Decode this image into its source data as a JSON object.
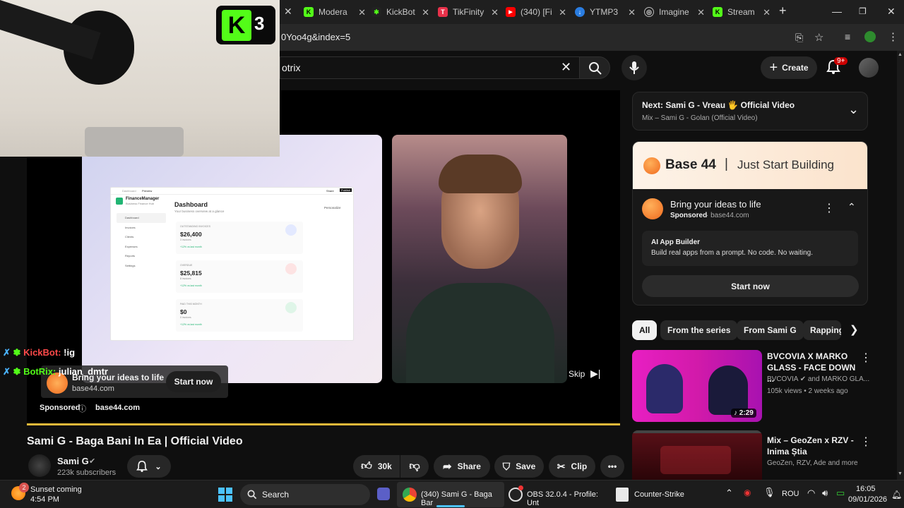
{
  "browser": {
    "tabs": [
      {
        "label": "Modera",
        "color": "#53fc18",
        "glyph": "K"
      },
      {
        "label": "KickBot",
        "color": "#1a1a1a",
        "glyph": "✱"
      },
      {
        "label": "TikFinity",
        "color": "#e8314a",
        "glyph": "T"
      },
      {
        "label": "(340) [Fi",
        "color": "#ff0000",
        "glyph": "▶"
      },
      {
        "label": "YTMP3",
        "color": "#2a7de1",
        "glyph": "↓"
      },
      {
        "label": "Imagine",
        "color": "#3a3a3a",
        "glyph": "◎"
      },
      {
        "label": "Stream",
        "color": "#53fc18",
        "glyph": "K"
      }
    ],
    "url": "0Yoo4g&index=5"
  },
  "header": {
    "search_query": "otrix",
    "create_label": "Create",
    "notif_badge": "9+"
  },
  "overlay": {
    "kick_number": "3",
    "chat": [
      {
        "user": "KickBot:",
        "msg": "!ig",
        "color": "#ff4a4a"
      },
      {
        "user": "BotRix:",
        "msg": "julian_dmtr",
        "color": "#53fc18"
      }
    ]
  },
  "ad": {
    "dashboard": {
      "app_name": "FinanceManager",
      "app_sub": "Business Finance Hub",
      "title": "Dashboard",
      "subtitle": "Your business overview at a glance",
      "personalize": "Personalize",
      "topbar": [
        "Dashboard",
        "Preview"
      ],
      "share": "Share",
      "publish": "Publish",
      "nav": [
        "Dashboard",
        "Invoices",
        "Clients",
        "Expenses",
        "Reports",
        "Settings"
      ],
      "cards": [
        {
          "label": "OUTSTANDING INVOICES",
          "value": "$26,400",
          "sub": "3 invoices",
          "trend": "+12% vs last month"
        },
        {
          "label": "OVERDUE",
          "value": "$25,815",
          "sub": "8 invoices",
          "trend": "+12% vs last month"
        },
        {
          "label": "PAID THIS MONTH",
          "value": "$0",
          "sub": "0 invoices",
          "trend": "+12% vs last month"
        }
      ]
    },
    "title": "Bring your ideas to life",
    "domain": "base44.com",
    "cta": "Start now",
    "sponsored": "Sponsored",
    "skip": "Skip"
  },
  "video": {
    "title": "Sami G - Baga Bani In Ea | Official Video",
    "channel": "Sami G",
    "subscribers": "223k subscribers",
    "likes": "30k",
    "share": "Share",
    "save": "Save",
    "clip": "Clip"
  },
  "sidebar": {
    "next_label": "Next: Sami G - Vreau 🖐 Official Video",
    "next_sub": "Mix – Sami G - Golan (Official Video)",
    "ad_brand": "Base 44",
    "ad_tagline": "Just Start Building",
    "ad_title": "Bring your ideas to life",
    "ad_sponsored": "Sponsored",
    "ad_domain": "base44.com",
    "ad_card_title": "AI App Builder",
    "ad_card_desc": "Build real apps from a prompt. No code. No waiting.",
    "ad_cta": "Start now",
    "chips": [
      "All",
      "From the series",
      "From Sami G",
      "Rapping"
    ],
    "videos": [
      {
        "title": "BVCOVIA X MARKO GLASS - FACE DOWN ...",
        "channel": "BVCOVIA",
        "channel_extra": "and MARKO GLA...",
        "meta": "105k views • 2 weeks ago",
        "duration": "2:29"
      },
      {
        "title": "Mix – GeoZen x RZV - Inima Știa",
        "channel": "GeoZen, RZV, Ade and more",
        "meta": "",
        "duration": ""
      }
    ]
  },
  "taskbar": {
    "weather_title": "Sunset coming",
    "weather_time": "4:54 PM",
    "weather_badge": "2",
    "search": "Search",
    "apps": [
      "(340) Sami G - Baga Bar",
      "OBS 32.0.4 - Profile: Unt",
      "Counter-Strike"
    ],
    "lang": "ROU",
    "time": "16:05",
    "date": "09/01/2026"
  }
}
